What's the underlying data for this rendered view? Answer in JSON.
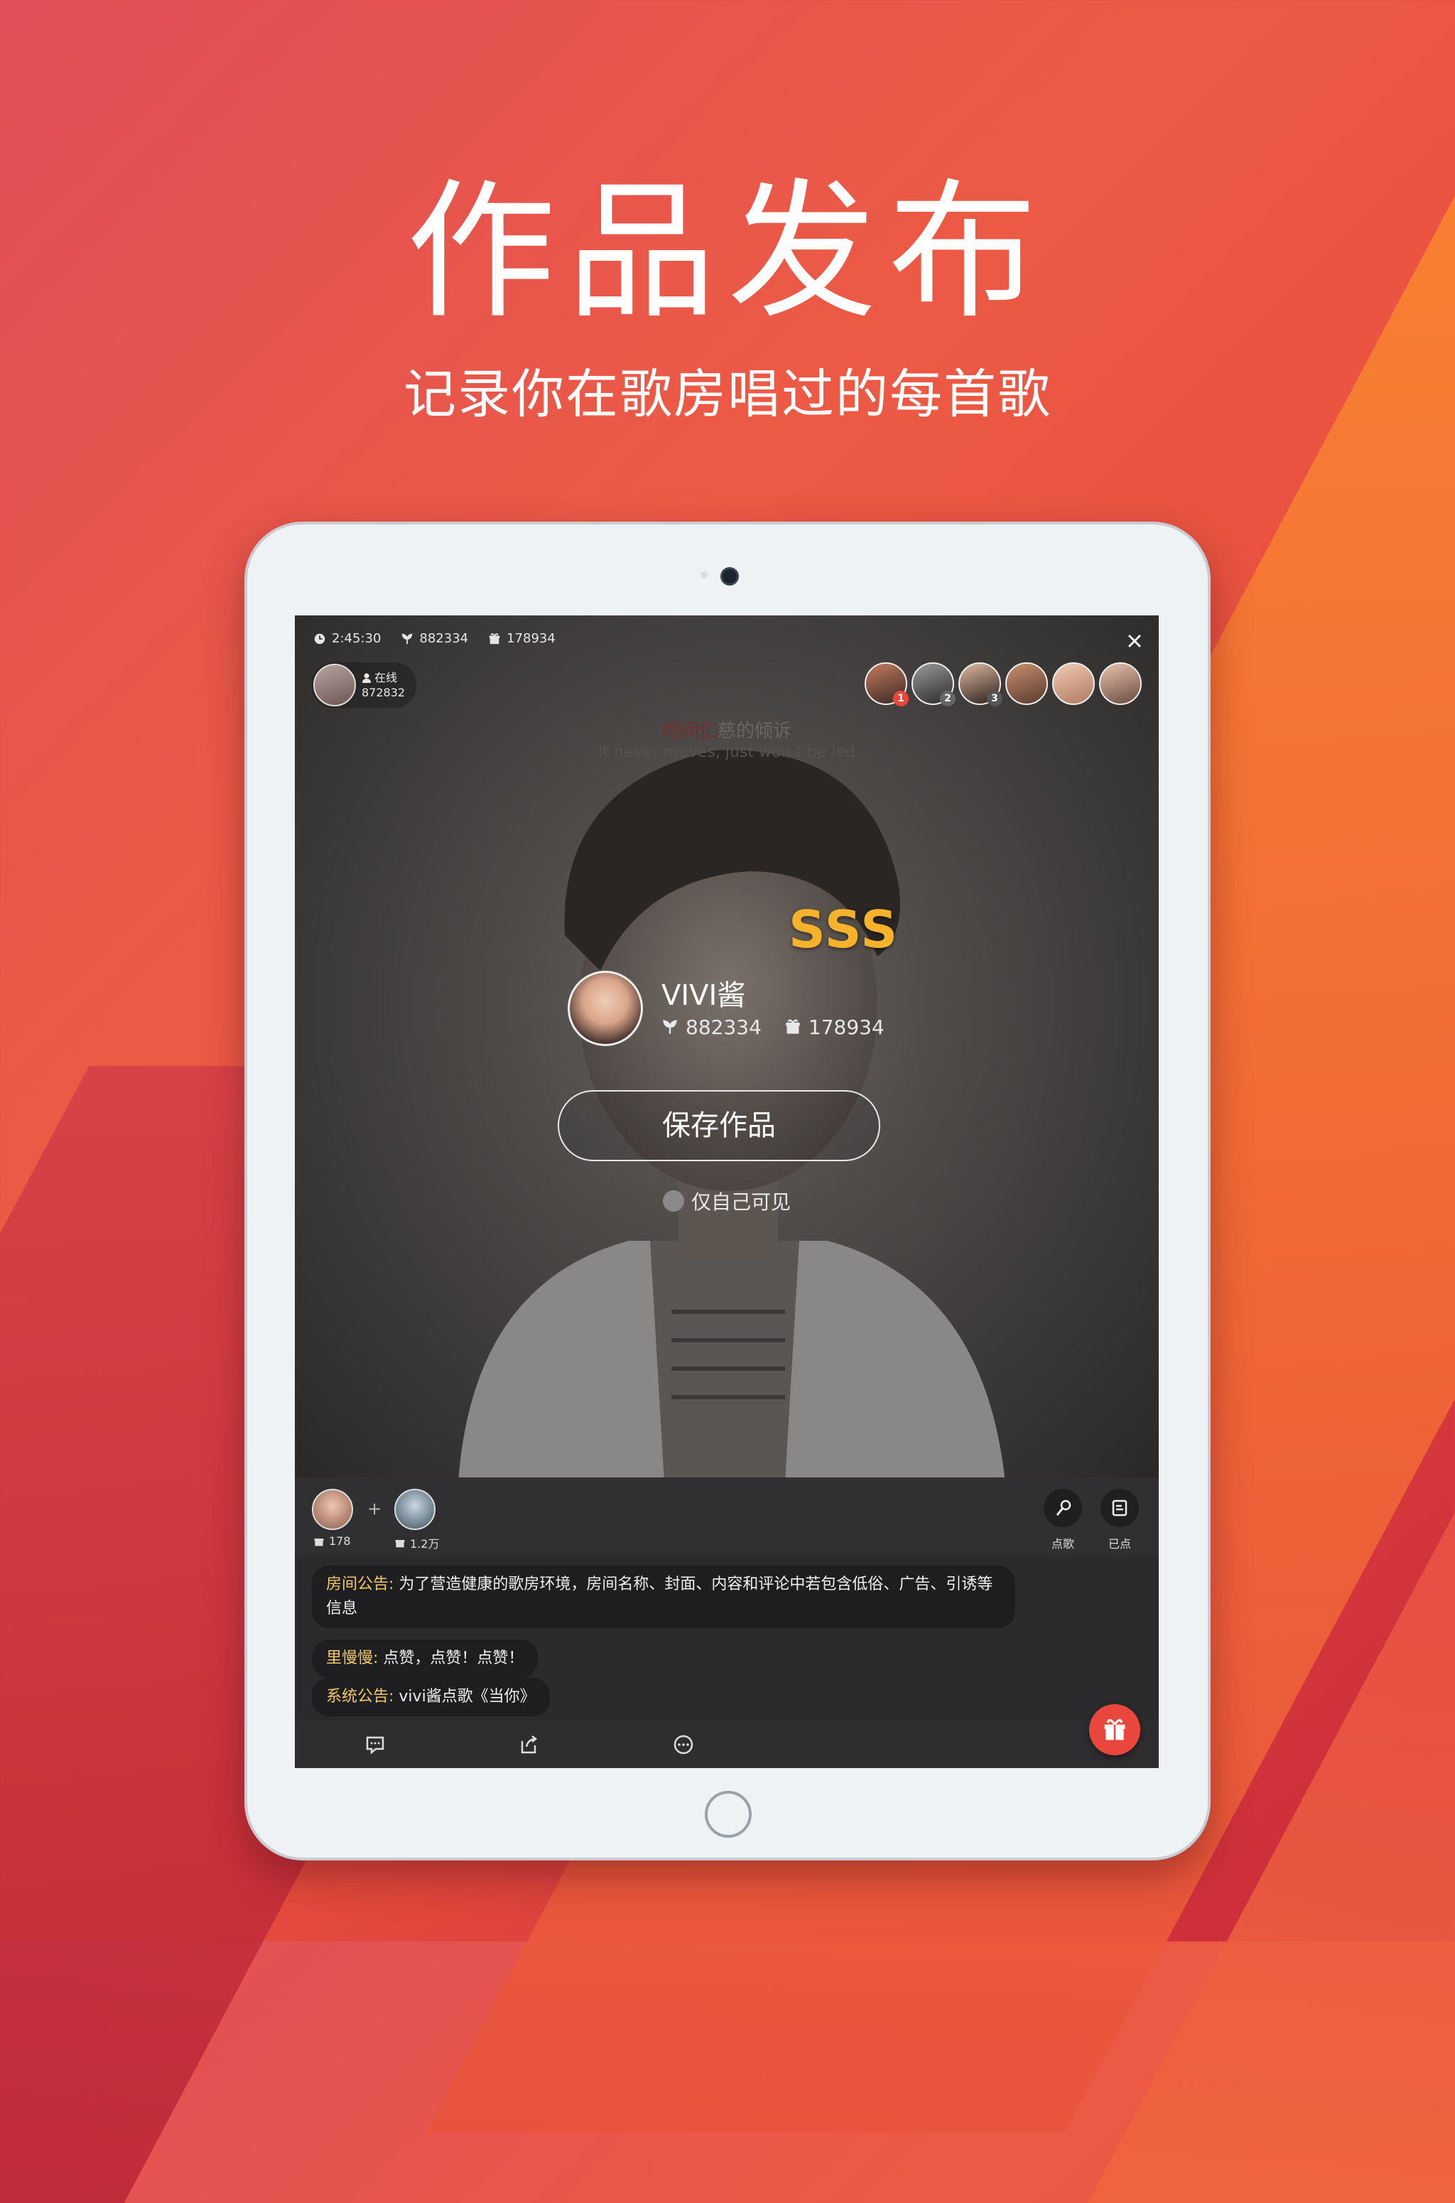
{
  "promo": {
    "title": "作品发布",
    "subtitle": "记录你在歌房唱过的每首歌"
  },
  "room": {
    "duration": "2:45:30",
    "flowers": "882334",
    "gifts": "178934",
    "host": {
      "status": "在线",
      "count": "872832"
    },
    "rank_badges": [
      "1",
      "2",
      "3"
    ]
  },
  "lyrics": {
    "line1_highlight": "时间仁",
    "line1_rest": "慈的倾诉",
    "line2": "It never moves, just won   t be led"
  },
  "result": {
    "grade": "SSS",
    "singer_name": "VIVI酱",
    "flowers": "882334",
    "gifts": "178934",
    "save_button": "保存作品",
    "private_label": "仅自己可见"
  },
  "duet": {
    "left_gifts": "178",
    "right_gifts": "1.2万",
    "plus": "+",
    "request_song": "点歌",
    "requested": "已点"
  },
  "chat": [
    {
      "who": "房间公告:",
      "text": " 为了营造健康的歌房环境，房间名称、封面、内容和评论中若包含低俗、广告、引诱等",
      "text2": "信息"
    },
    {
      "who": "里慢慢:",
      "text": " 点赞，点赞！点赞！"
    },
    {
      "who": "系统公告:",
      "text": " vivi酱点歌《当你》"
    }
  ],
  "colors": {
    "accent": "#e9473d",
    "grade": "#f6b22a",
    "chat_name": "#f3c86a"
  }
}
